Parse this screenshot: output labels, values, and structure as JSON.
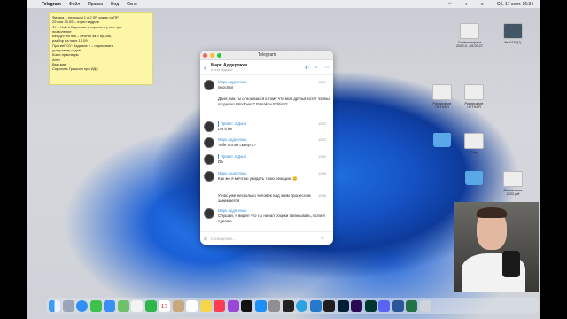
{
  "menubar": {
    "app": "Telegram",
    "items": [
      "Файл",
      "Правка",
      "Вид",
      "Окно"
    ],
    "clock": "Сб, 17 сент. 16:34"
  },
  "sticky": {
    "lines": [
      "Физика – протокол 1 и 2 ЛР, какие-то ПР",
      "29 или 30.09 – отдел кадров",
      "Ф/ – Найти Карпенко и спросить у нее про",
      "позволение",
      "ВебДИТехПеж – отчеты за 9 пр,раб,",
      "разбор на паре 15.09",
      "ПрогинПОУ: Задание 2 – нарисовать",
      "диаграмму кодов",
      "Комп.практикум",
      "Англ",
      "Вып.мат",
      "Спросить Гришину про ИДЗ"
    ]
  },
  "telegram": {
    "title": "Telegram",
    "chat_name": "Марк Аддерлюш",
    "chat_status": "в сети недавно",
    "composer_placeholder": "Сообщение...",
    "messages": [
      {
        "name": "Марк Аддерлюш",
        "text": "проспал",
        "time": "12:51"
      },
      {
        "name": "",
        "text": "Даня, как ты относишься к тому что мои друзья хотят чтобы я сделал Windows 7 Ermakov Edition?",
        "time": "12:53"
      },
      {
        "name": "",
        "reply": "Привет, я Даня",
        "text": "Let it be",
        "time": "12:53"
      },
      {
        "name": "Марк Аддерлюш",
        "text": "тебе потом скинуть?",
        "time": "12:53"
      },
      {
        "name": "",
        "reply": "Привет, я Даня",
        "text": "Da",
        "time": "12:54"
      },
      {
        "name": "Марк Аддерлюш",
        "text": "Как же я мечтаю увидеть твою реакцию 😊",
        "time": "12:55"
      },
      {
        "name": "",
        "text": "У нас уже несколько человек над этим процессом занимается",
        "time": "12:56"
      },
      {
        "name": "Марк Аддерлюш",
        "text": "Слушай, я видел что ты начал сборки записывать, если я сделаю",
        "time": ""
      }
    ]
  },
  "desktop_icons": [
    "Снимок экрана 2022-0...15.09.27",
    "flex0150(1)",
    "Расписание ЧЕТНАЯ",
    "Расписание ЧЁТНАЯ",
    "",
    "Play",
    "",
    "Расписание 2022.pdf"
  ],
  "dock": {
    "apps": [
      "Finder",
      "Launchpad",
      "Safari",
      "Messages",
      "Mail",
      "Maps",
      "Photos",
      "FaceTime",
      "Calendar",
      "Contacts",
      "Reminders",
      "Notes",
      "Music",
      "Podcasts",
      "TV",
      "App Store",
      "Preferences",
      "Terminal",
      "Telegram",
      "VS Code",
      "PyCharm",
      "Photoshop",
      "Premiere",
      "Audition",
      "Discord",
      "Word",
      "Excel",
      "Trash"
    ],
    "calendar_day": "17"
  },
  "colors": {
    "telegram_accent": "#3a8fd8",
    "sticky_bg": "#fdf6a6",
    "wallpaper_blue": "#1552c4"
  }
}
